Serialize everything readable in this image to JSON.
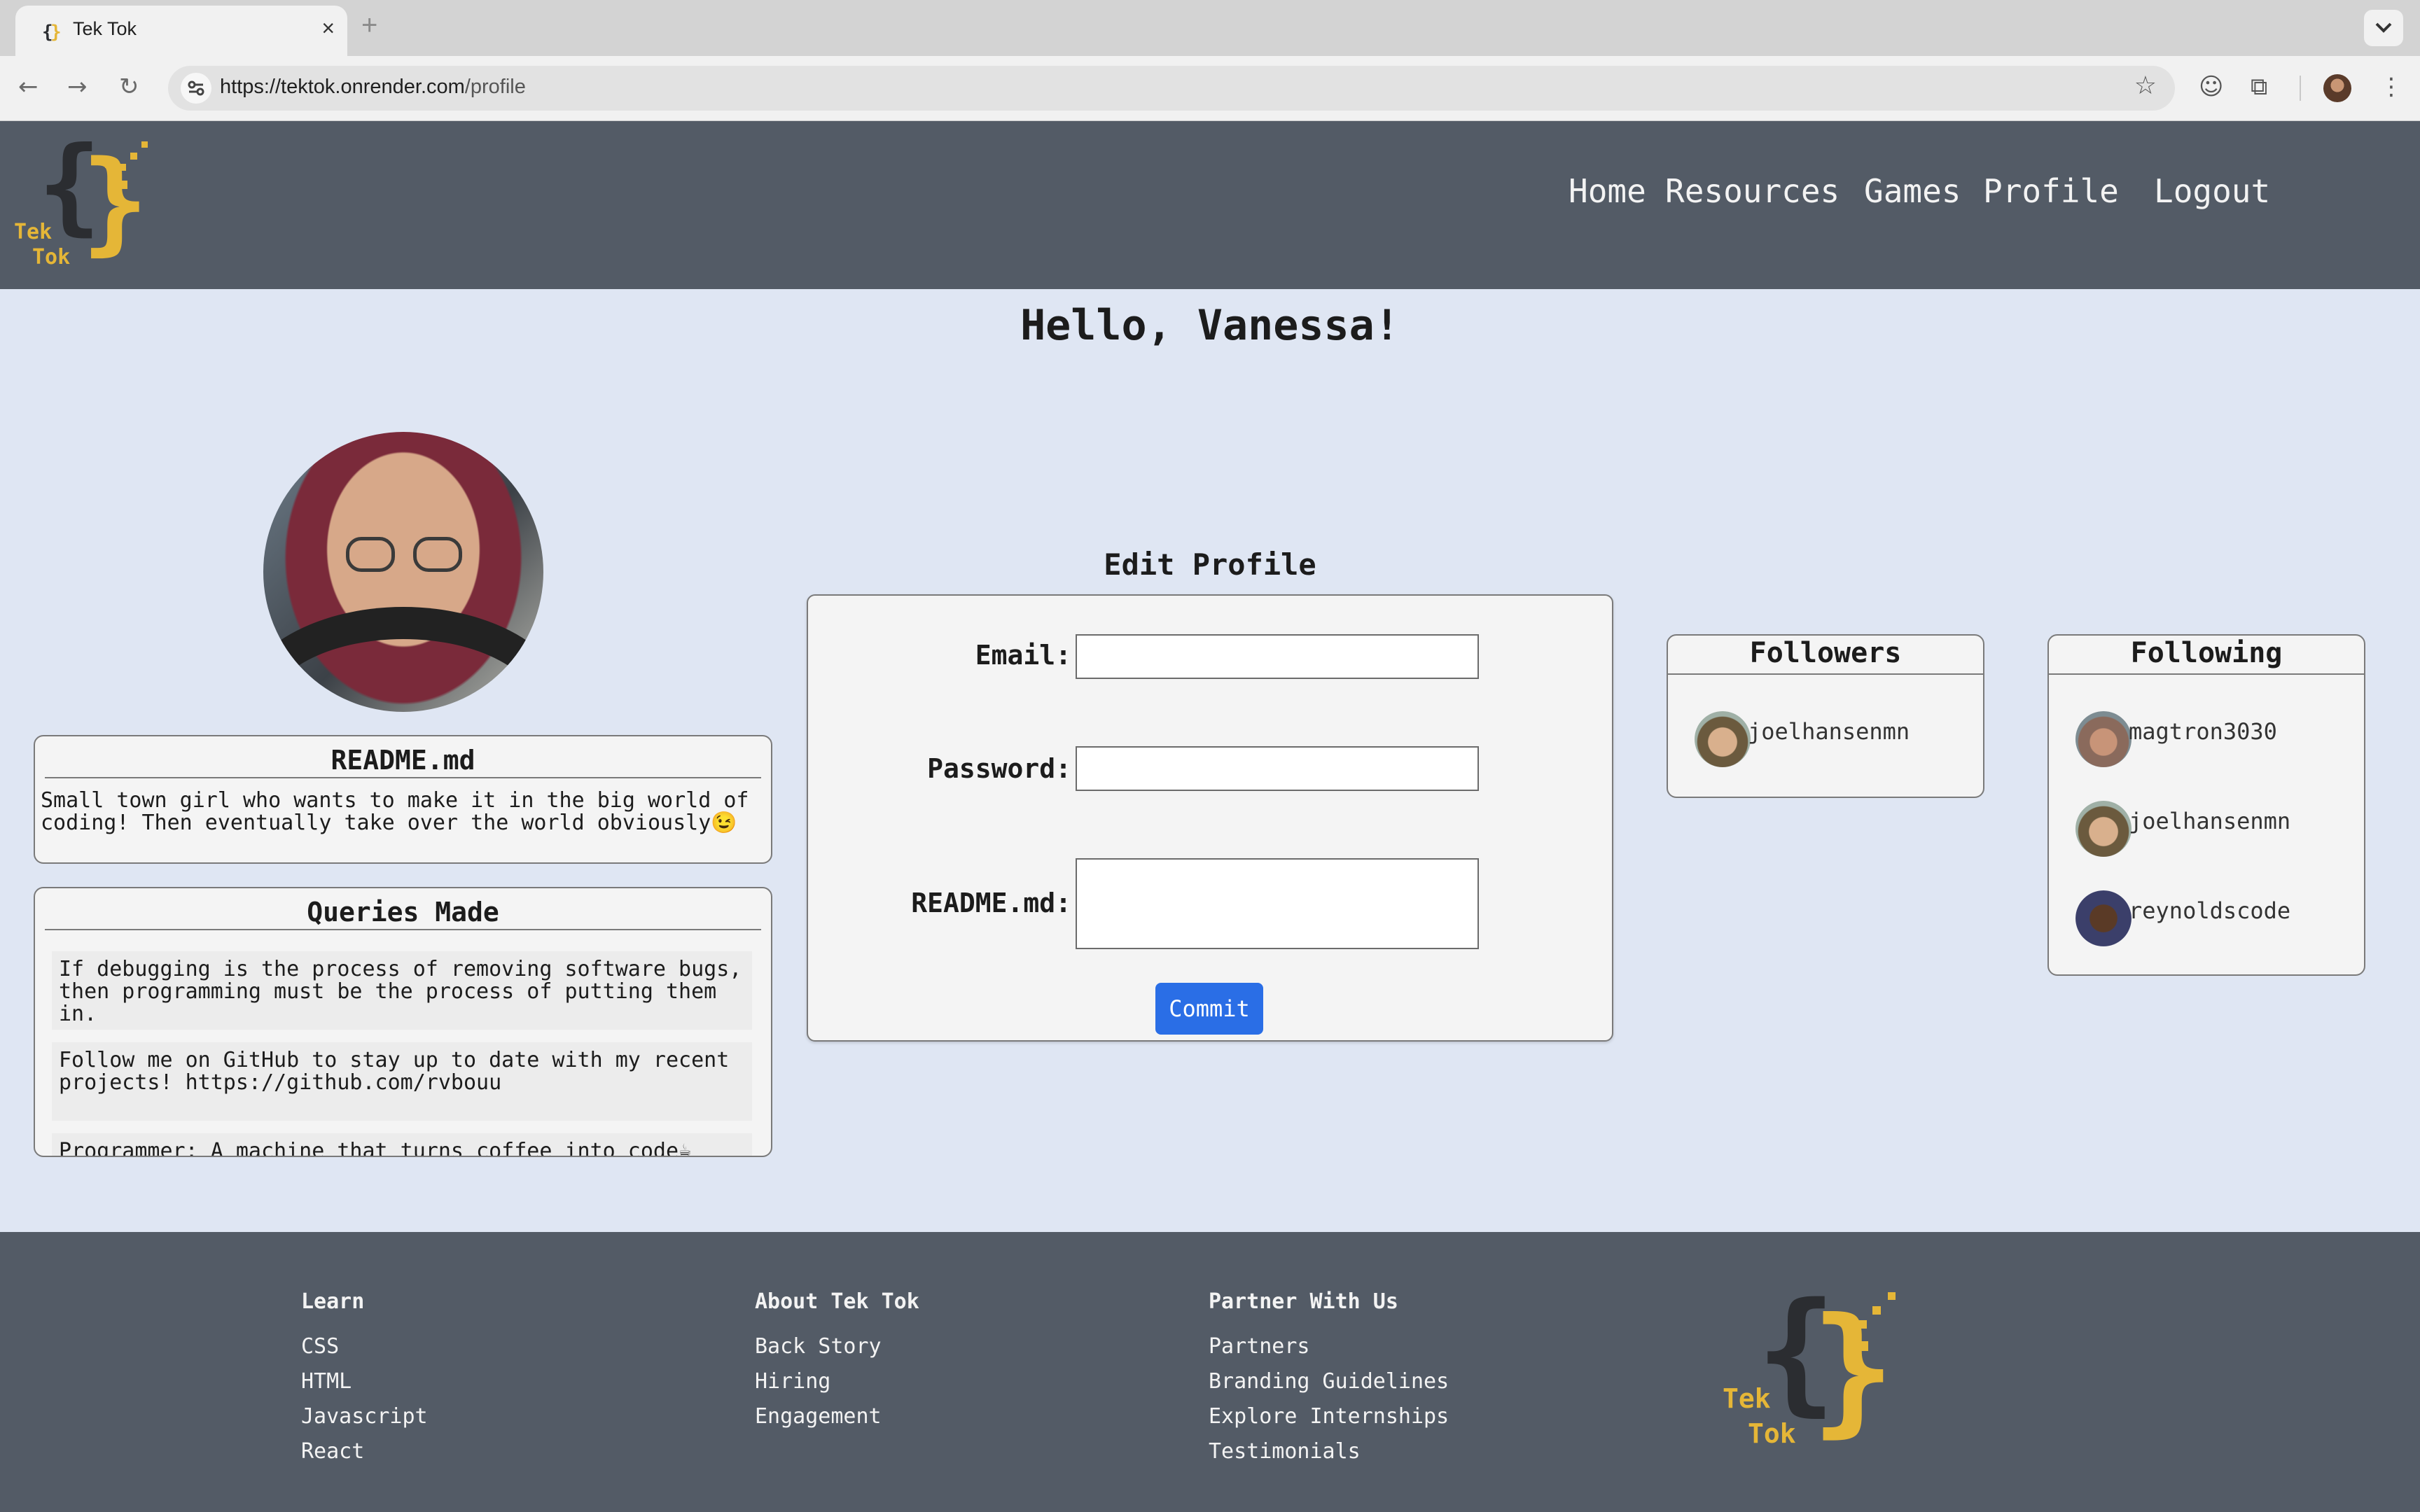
{
  "browser": {
    "tab_title": "Tek Tok",
    "tab_close": "×",
    "new_tab": "+",
    "url_host": "https://tektok.onrender.com",
    "url_path": "/profile"
  },
  "site": {
    "logo_brace_left": "{",
    "logo_brace_right": "}",
    "logo_word_1": "Tek",
    "logo_word_2": "Tok",
    "nav": [
      "Home",
      "Resources",
      "Games",
      "Profile",
      "Logout"
    ]
  },
  "greeting": "Hello, Vanessa!",
  "readme": {
    "title": "README.md",
    "text": "Small town girl who wants to make it in the big world of coding! Then eventually take over the world obviously😉"
  },
  "queries": {
    "title": "Queries Made",
    "items": [
      "If debugging is the process of removing software bugs, then programming must be the process of putting them in.",
      "Follow me on GitHub to stay up to date with my recent projects! https://github.com/rvbouu",
      "Programmer: A machine that turns coffee into code☕"
    ]
  },
  "edit_profile": {
    "title": "Edit Profile",
    "email_label": "Email:",
    "password_label": "Password:",
    "readme_label": "README.md:",
    "email_value": "",
    "password_value": "",
    "readme_value": "",
    "commit_label": "Commit"
  },
  "followers": {
    "title": "Followers",
    "users": [
      "joelhansenmn"
    ]
  },
  "following": {
    "title": "Following",
    "users": [
      "magtron3030",
      "joelhansenmn",
      "reynoldscode"
    ]
  },
  "footer": {
    "columns": [
      {
        "heading": "Learn",
        "links": [
          "CSS",
          "HTML",
          "Javascript",
          "React"
        ]
      },
      {
        "heading": "About Tek Tok",
        "links": [
          "Back Story",
          "Hiring",
          "Engagement"
        ]
      },
      {
        "heading": "Partner With Us",
        "links": [
          "Partners",
          "Branding Guidelines",
          "Explore Internships",
          "Testimonials"
        ]
      }
    ]
  },
  "colors": {
    "header_bg": "#535b66",
    "page_bg": "#dfe6f3",
    "brand_yellow": "#e5b637",
    "button_blue": "#2a6ee6"
  }
}
